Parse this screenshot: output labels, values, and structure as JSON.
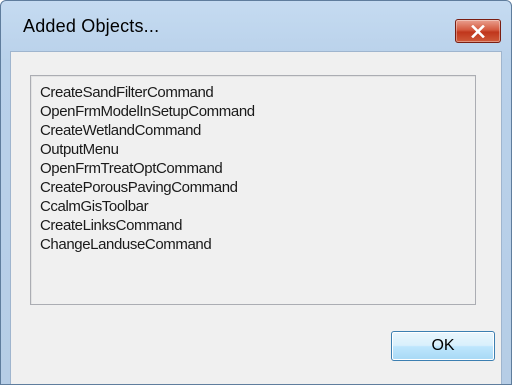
{
  "window": {
    "title": "Added Objects...",
    "close_icon": "close-icon",
    "colors": {
      "frame": "#b9d1ea",
      "close_button": "#c7472b",
      "ok_button": "#bee6fd"
    }
  },
  "added_objects": {
    "items": [
      "CreateSandFilterCommand",
      "OpenFrmModelInSetupCommand",
      "CreateWetlandCommand",
      "OutputMenu",
      "OpenFrmTreatOptCommand",
      "CreatePorousPavingCommand",
      "CcalmGisToolbar",
      "CreateLinksCommand",
      "ChangeLanduseCommand"
    ]
  },
  "buttons": {
    "ok_label": "OK"
  }
}
